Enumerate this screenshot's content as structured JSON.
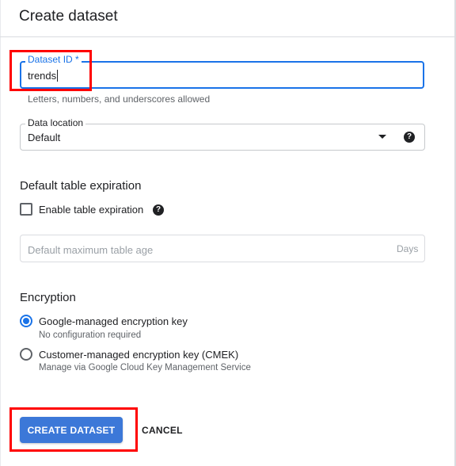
{
  "dialog": {
    "title": "Create dataset"
  },
  "dataset_id": {
    "label": "Dataset ID *",
    "value": "trends",
    "helper": "Letters, numbers, and underscores allowed"
  },
  "data_location": {
    "label": "Data location",
    "value": "Default",
    "dropdown_icon": "arrow-drop-down-icon",
    "help_icon": "help-circle-icon"
  },
  "expiration": {
    "heading": "Default table expiration",
    "checkbox_label": "Enable table expiration",
    "checked": false,
    "help_icon": "help-circle-icon",
    "age_placeholder": "Default maximum table age",
    "age_suffix": "Days"
  },
  "encryption": {
    "heading": "Encryption",
    "options": [
      {
        "title": "Google-managed encryption key",
        "subtitle": "No configuration required",
        "selected": true
      },
      {
        "title": "Customer-managed encryption key (CMEK)",
        "subtitle": "Manage via Google Cloud Key Management Service",
        "selected": false
      }
    ]
  },
  "actions": {
    "create_label": "CREATE DATASET",
    "cancel_label": "CANCEL"
  },
  "colors": {
    "accent": "#1a73e8",
    "primary_button": "#3c78d8",
    "highlight": "#ff0000"
  }
}
